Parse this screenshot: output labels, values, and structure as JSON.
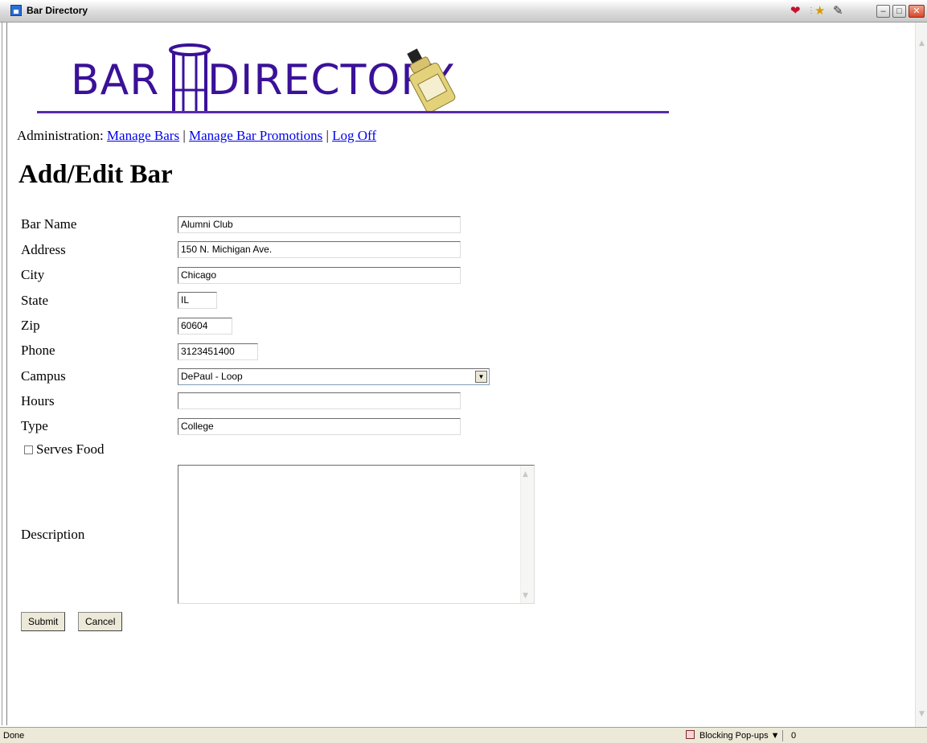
{
  "window": {
    "title": "Bar Directory",
    "tray_icons": [
      "heart-icon",
      "runner-icon",
      "edit-icon"
    ],
    "controls": [
      "minimize",
      "maximize",
      "close"
    ]
  },
  "logo": {
    "text_bar": "BAR",
    "text_directory": "DIRECTORY"
  },
  "nav": {
    "prefix": "Administration:",
    "links": [
      "Manage Bars",
      "Manage Bar Promotions",
      "Log Off"
    ],
    "separator": "|"
  },
  "page": {
    "title": "Add/Edit Bar"
  },
  "form": {
    "labels": {
      "bar_name": "Bar Name",
      "address": "Address",
      "city": "City",
      "state": "State",
      "zip": "Zip",
      "phone": "Phone",
      "campus": "Campus",
      "hours": "Hours",
      "type": "Type",
      "serves_food": "Serves Food",
      "description": "Description"
    },
    "values": {
      "bar_name": "Alumni Club",
      "address": "150 N. Michigan Ave.",
      "city": "Chicago",
      "state": "IL",
      "zip": "60604",
      "phone": "3123451400",
      "campus": "DePaul - Loop",
      "hours": "",
      "type": "College",
      "description": ""
    },
    "serves_food_checked": false,
    "buttons": {
      "submit": "Submit",
      "cancel": "Cancel"
    }
  },
  "status": {
    "text": "Done",
    "popup_text": "Blocking Pop-ups",
    "popup_count": "0"
  },
  "colors": {
    "logo": "#3a1198",
    "link": "#0000ee",
    "statusbar": "#ece9d8"
  }
}
